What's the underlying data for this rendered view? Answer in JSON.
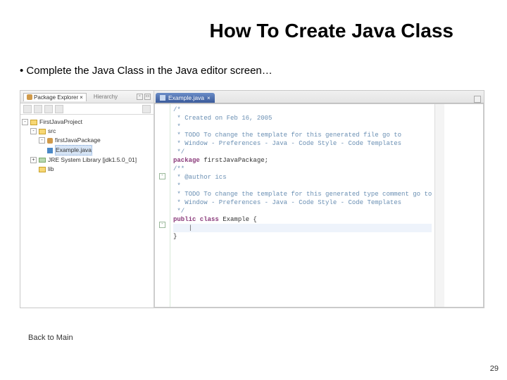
{
  "title": "How To Create Java Class",
  "bullet": "•   Complete the Java Class in the Java editor screen…",
  "backlink": "Back to Main",
  "pagenum": "29",
  "explorer": {
    "tab_active": "Package Explorer",
    "tab_inactive": "Hierarchy",
    "project": "FirstJavaProject",
    "src": "src",
    "package": "firstJavaPackage",
    "file": "Example.java",
    "jre": "JRE System Library [jdk1.5.0_01]",
    "lib": "lib"
  },
  "editor": {
    "tab": "Example.java",
    "lines": {
      "l0": "/*",
      "l1": " * Created on Feb 16, 2005",
      "l2": " *",
      "l3": " * TODO To change the template for this generated file go to",
      "l4": " * Window - Preferences - Java - Code Style - Code Templates",
      "l5": " */",
      "l6a": "package",
      "l6b": " firstJavaPackage;",
      "l7": "",
      "l8": "/**",
      "l9": " * @author ics",
      "l10": " *",
      "l11": " * TODO To change the template for this generated type comment go to",
      "l12": " * Window - Preferences - Java - Code Style - Code Templates",
      "l13": " */",
      "l14a": "public class",
      "l14b": " Example {",
      "l15": "    |",
      "l16": "}"
    }
  }
}
